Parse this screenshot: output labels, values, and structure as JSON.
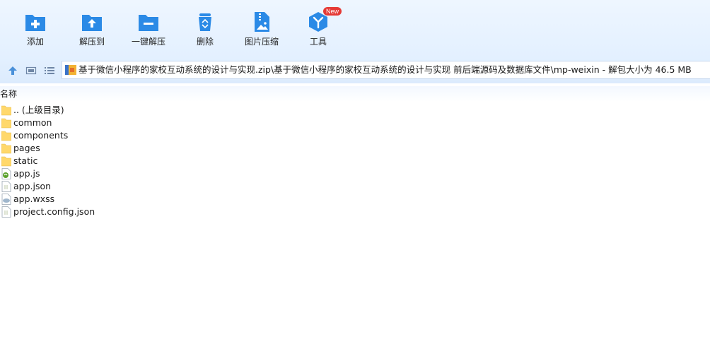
{
  "toolbar": {
    "add": "添加",
    "extract_to": "解压到",
    "one_click_extract": "一键解压",
    "delete": "删除",
    "image_compress": "图片压缩",
    "tools": "工具",
    "new_badge": "New"
  },
  "address": {
    "path": "基于微信小程序的家校互动系统的设计与实现.zip\\基于微信小程序的家校互动系统的设计与实现 前后端源码及数据库文件\\mp-weixin - 解包大小为 46.5 MB"
  },
  "columns": {
    "name": "名称"
  },
  "files": [
    {
      "name": ".. (上级目录)",
      "icon": "folder-icon"
    },
    {
      "name": "common",
      "icon": "folder-icon"
    },
    {
      "name": "components",
      "icon": "folder-icon"
    },
    {
      "name": "pages",
      "icon": "folder-icon"
    },
    {
      "name": "static",
      "icon": "folder-icon"
    },
    {
      "name": "app.js",
      "icon": "js-file-icon"
    },
    {
      "name": "app.json",
      "icon": "json-file-icon"
    },
    {
      "name": "app.wxss",
      "icon": "wxss-file-icon"
    },
    {
      "name": "project.config.json",
      "icon": "json-file-icon"
    }
  ],
  "colors": {
    "accent": "#2b8ae6",
    "folder": "#ffd86b",
    "badge": "#e53935"
  }
}
